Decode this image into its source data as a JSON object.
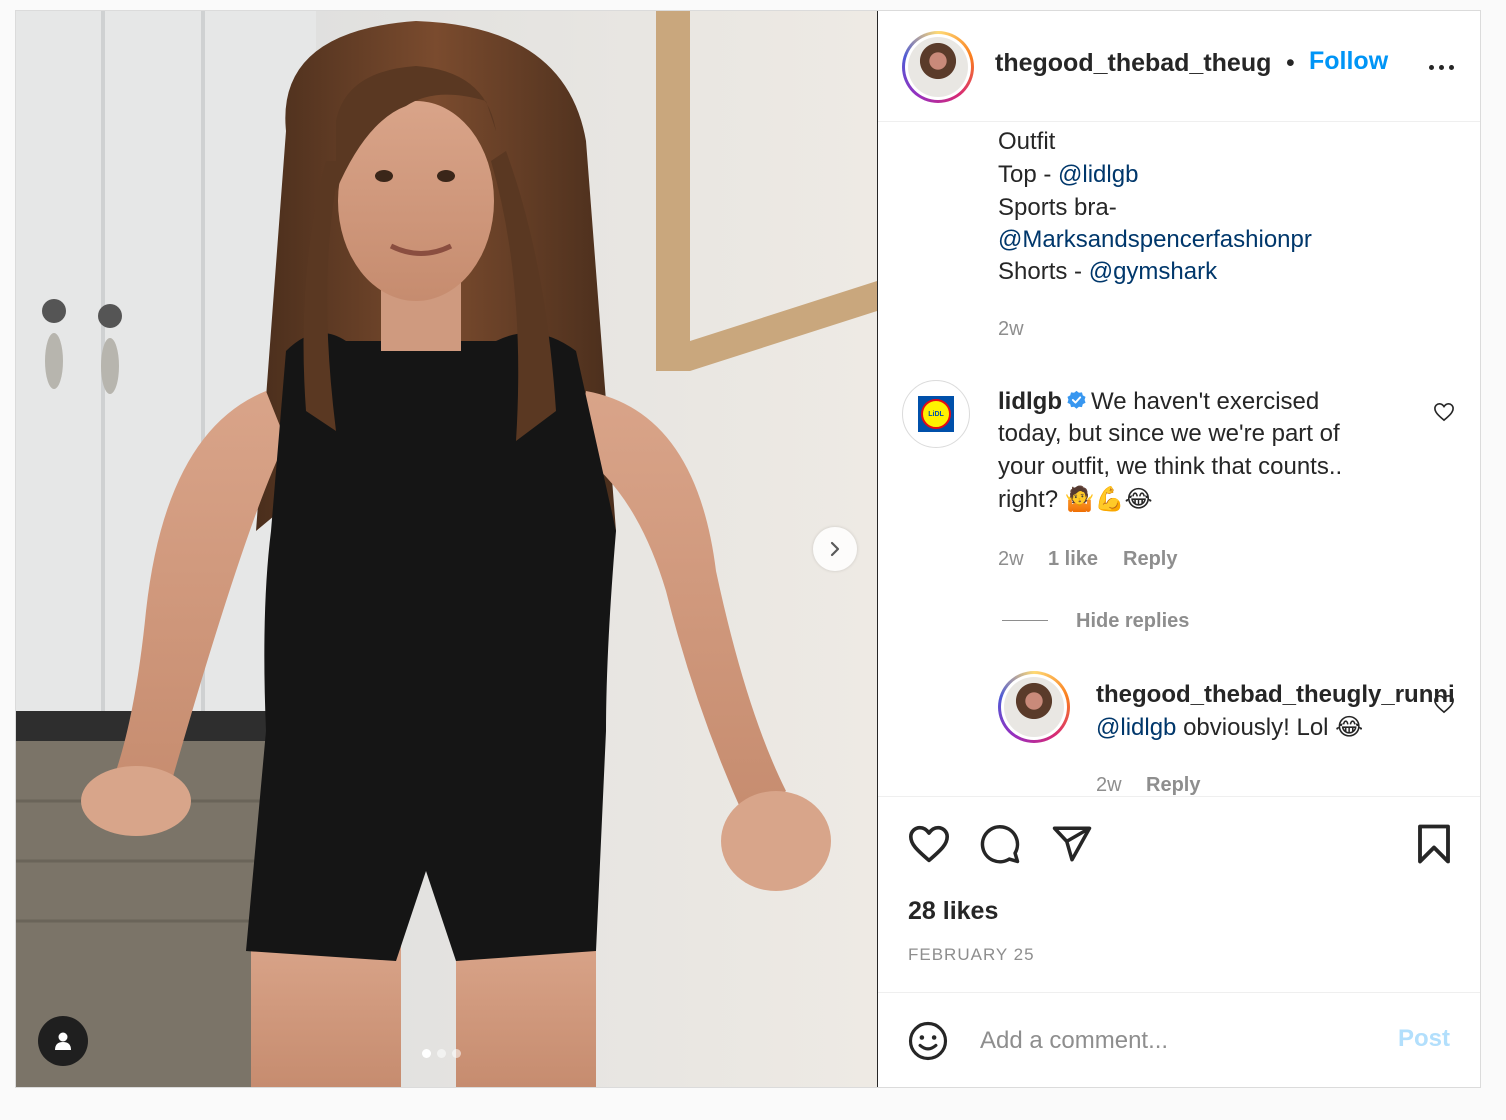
{
  "header": {
    "username": "thegood_thebad_theug",
    "separator": "•",
    "follow_label": "Follow"
  },
  "caption": {
    "line1": "Outfit",
    "line2_prefix": "Top - ",
    "line2_mention": "@lidlgb",
    "line3": "Sports bra-",
    "line4_mention": "@Marksandspencerfashionpr",
    "line5_prefix": "Shorts - ",
    "line5_mention": "@gymshark",
    "time": "2w"
  },
  "comment": {
    "username": "lidlgb",
    "line1": "We haven't exercised",
    "line2": "today, but since we we're part of",
    "line3": "your outfit, we think that counts..",
    "line4": "right? 🤷💪😂",
    "time": "2w",
    "likes": "1 like",
    "reply_label": "Reply",
    "hide_replies": "Hide replies"
  },
  "reply": {
    "username": "thegood_thebad_theugly_runni",
    "mention": "@lidlgb",
    "text": " obviously! Lol 😂",
    "time": "2w",
    "reply_label": "Reply"
  },
  "stats": {
    "likes": "28 likes",
    "date": "FEBRUARY 25"
  },
  "add_comment": {
    "placeholder": "Add a comment...",
    "post_label": "Post"
  },
  "carousel": {
    "slide_count": 3,
    "active_slide": 1
  },
  "colors": {
    "accent": "#0095f6",
    "mention": "#00376b",
    "muted": "#8e8e8e",
    "post_disabled": "#b2dffc"
  }
}
